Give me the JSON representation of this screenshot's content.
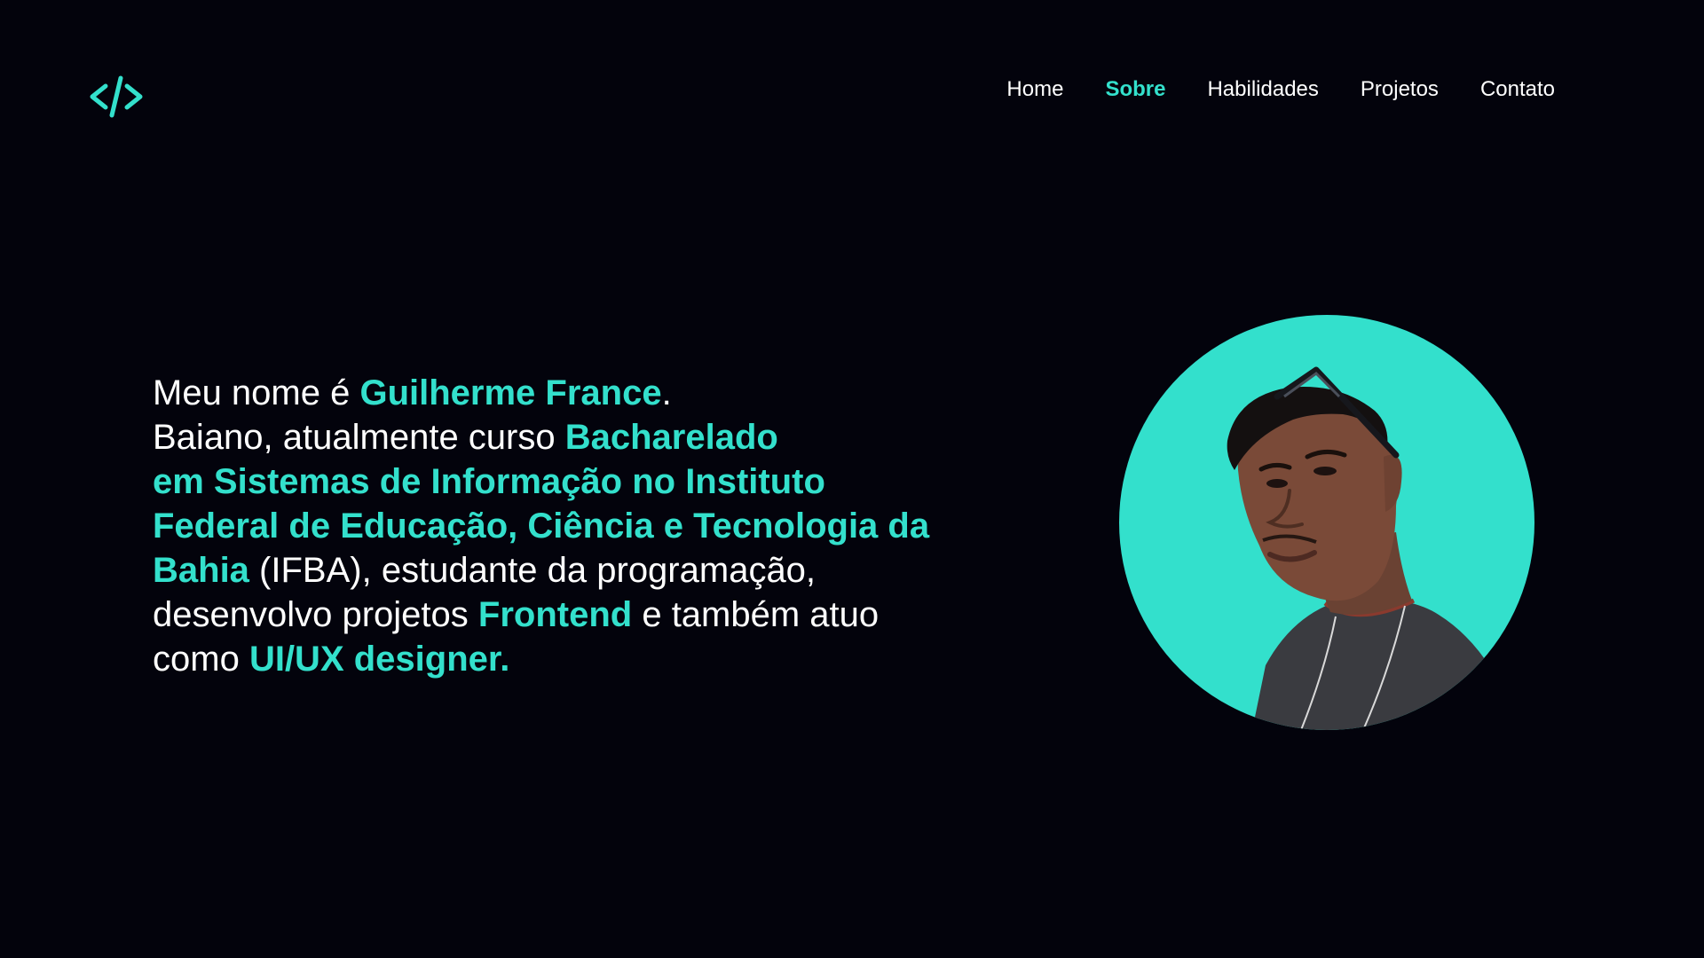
{
  "brand": {
    "logo_icon": "code-brackets-icon",
    "accent_color": "#33e0cc",
    "background_color": "#03030c"
  },
  "nav": {
    "items": [
      {
        "label": "Home",
        "active": false
      },
      {
        "label": "Sobre",
        "active": true
      },
      {
        "label": "Habilidades",
        "active": false
      },
      {
        "label": "Projetos",
        "active": false
      },
      {
        "label": "Contato",
        "active": false
      }
    ]
  },
  "about": {
    "line1": {
      "a": "Meu nome é ",
      "b": "Guilherme France",
      "c": "."
    },
    "line2": {
      "a": "Baiano, atualmente curso ",
      "b": "Bacharelado"
    },
    "line3": {
      "b": "em Sistemas de Informação no Instituto"
    },
    "line4": {
      "b": "Federal de Educação, Ciência e Tecnologia da"
    },
    "line5": {
      "b": "Bahia",
      "a": " (IFBA), estudante da programação,"
    },
    "line6": {
      "a": "desenvolvo projetos ",
      "b": "Frontend",
      "c": " e também atuo"
    },
    "line7": {
      "a": "como ",
      "b": "UI/UX designer."
    }
  },
  "profile": {
    "photo_icon": "profile-photo",
    "circle_color": "#33e0cc"
  }
}
